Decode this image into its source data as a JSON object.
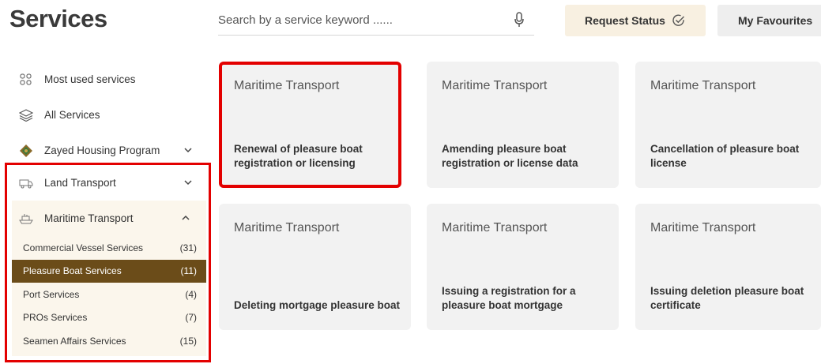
{
  "header": {
    "title": "Services",
    "search_placeholder": "Search by a service keyword ......",
    "request_status_label": "Request Status",
    "favourites_label": "My Favourites"
  },
  "sidebar": {
    "most_used": "Most used services",
    "all_services": "All Services",
    "zayed_housing": "Zayed Housing Program",
    "land_transport": "Land Transport",
    "maritime_transport": "Maritime Transport",
    "sub_items": [
      {
        "label": "Commercial Vessel Services",
        "count": "(31)"
      },
      {
        "label": "Pleasure Boat Services",
        "count": "(11)"
      },
      {
        "label": "Port Services",
        "count": "(4)"
      },
      {
        "label": "PROs Services",
        "count": "(7)"
      },
      {
        "label": "Seamen Affairs Services",
        "count": "(15)"
      }
    ]
  },
  "cards": [
    {
      "category": "Maritime Transport",
      "name": "Renewal of pleasure boat registration or licensing"
    },
    {
      "category": "Maritime Transport",
      "name": "Amending pleasure boat registration or license data"
    },
    {
      "category": "Maritime Transport",
      "name": "Cancellation of pleasure boat license"
    },
    {
      "category": "Maritime Transport",
      "name": "Deleting mortgage pleasure boat"
    },
    {
      "category": "Maritime Transport",
      "name": "Issuing a registration for a pleasure boat mortgage"
    },
    {
      "category": "Maritime Transport",
      "name": "Issuing deletion pleasure boat certificate"
    }
  ],
  "colors": {
    "accent_brown": "#6b4c19",
    "highlight_red": "#e30000",
    "request_bg": "#f8f0e1",
    "card_bg": "#f2f2f2"
  },
  "icons": {
    "most_used": "grid-icon",
    "all_services": "layers-icon",
    "zayed": "emblem-icon",
    "land": "truck-icon",
    "maritime": "ship-icon",
    "mic": "microphone-icon",
    "request": "check-circle-icon"
  }
}
